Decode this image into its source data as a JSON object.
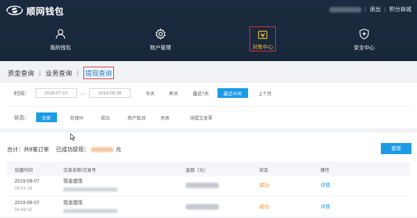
{
  "app": {
    "logo_text": "顺网钱包",
    "colors": {
      "header_bg": "#1b2a3e",
      "accent_blue": "#1c9be5",
      "active_nav": "#f6c244",
      "highlight_red": "#e0343a",
      "status_success": "#f08c27"
    }
  },
  "top_links": {
    "logout": "退出",
    "points_mall": "积分商城",
    "separator": "|"
  },
  "nav": {
    "items": [
      {
        "label": "我的钱包",
        "icon": "user-icon"
      },
      {
        "label": "账户管理",
        "icon": "gear-icon"
      },
      {
        "label": "对账中心",
        "icon": "reconcile-icon",
        "active": true
      },
      {
        "label": "安全中心",
        "icon": "shield-icon"
      }
    ]
  },
  "subtabs": {
    "items": [
      "资金查询",
      "业务查询",
      "提现查询"
    ],
    "separator": "|",
    "active_index": 2
  },
  "filters": {
    "time_label": "时间：",
    "start_date": "2019-07-10",
    "end_date": "2019-08-08",
    "dash": "—",
    "quick": [
      "今天",
      "昨天",
      "最近7天",
      "最近30天",
      "上个月"
    ],
    "quick_active": "最近30天",
    "status_label": "状态：",
    "status_options": [
      "全部",
      "处理中",
      "成功",
      "用户取消",
      "失败",
      "待提交发票"
    ],
    "status_active": "全部"
  },
  "summary": {
    "total_text": "合计：共9笔订单",
    "withdrawn_label": "已成功提现：",
    "unit": "元",
    "withdraw_button": "提现"
  },
  "table": {
    "headers": [
      "创建时间",
      "交易名称/交易号",
      "金额（元）",
      "状态",
      "操作"
    ],
    "rows": [
      {
        "date": "2019-08-07",
        "time": "09:31:18",
        "name": "现金提现",
        "status": "成功",
        "action": "详情"
      },
      {
        "date": "2019-08-07",
        "time": "00:48:32",
        "name": "现金提现",
        "status": "成功",
        "action": "详情"
      }
    ]
  }
}
